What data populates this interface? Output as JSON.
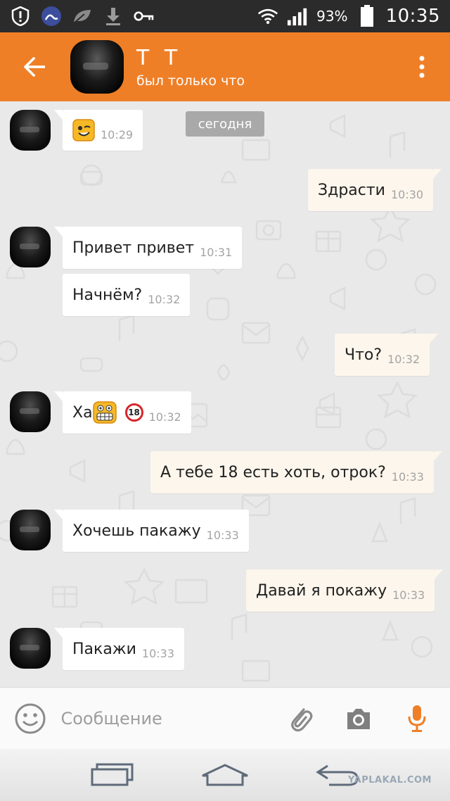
{
  "status_bar": {
    "battery_percent": "93%",
    "time": "10:35",
    "icons": [
      "alert-icon",
      "app-icon",
      "leaf-icon",
      "download-icon",
      "key-icon",
      "wifi-icon",
      "signal-icon",
      "battery-icon"
    ]
  },
  "header": {
    "contact_name": "Т Т",
    "contact_status": "был только что",
    "back_icon": "arrow-left-icon",
    "menu_icon": "more-vert-icon"
  },
  "chat": {
    "date_label": "сегодня",
    "messages": [
      {
        "dir": "in",
        "text": "",
        "emoji": "wink-smiley",
        "time": "10:29"
      },
      {
        "dir": "out",
        "text": "Здрасти",
        "time": "10:30"
      },
      {
        "dir": "in",
        "text": "Привет привет",
        "time": "10:31"
      },
      {
        "dir": "in",
        "text": "Начнём?",
        "time": "10:32"
      },
      {
        "dir": "out",
        "text": "Что?",
        "time": "10:32"
      },
      {
        "dir": "in",
        "text": "Ха",
        "emoji": "grin-smiley",
        "badge": "18",
        "time": "10:32"
      },
      {
        "dir": "out",
        "text": "А тебе 18 есть хоть, отрок?",
        "time": "10:33"
      },
      {
        "dir": "in",
        "text": "Хочешь пакажу",
        "time": "10:33"
      },
      {
        "dir": "out",
        "text": "Давай я покажу",
        "time": "10:33"
      },
      {
        "dir": "in",
        "text": "Пакажи",
        "time": "10:33"
      }
    ]
  },
  "input_bar": {
    "placeholder": "Сообщение",
    "accent_color": "#ef7f27"
  },
  "colors": {
    "header_bg": "#ef7f27",
    "incoming_bubble": "#ffffff",
    "outgoing_bubble": "#fcf6ec",
    "chat_bg": "#e9e9e9"
  },
  "watermark": "YAPLAKAL.COM"
}
